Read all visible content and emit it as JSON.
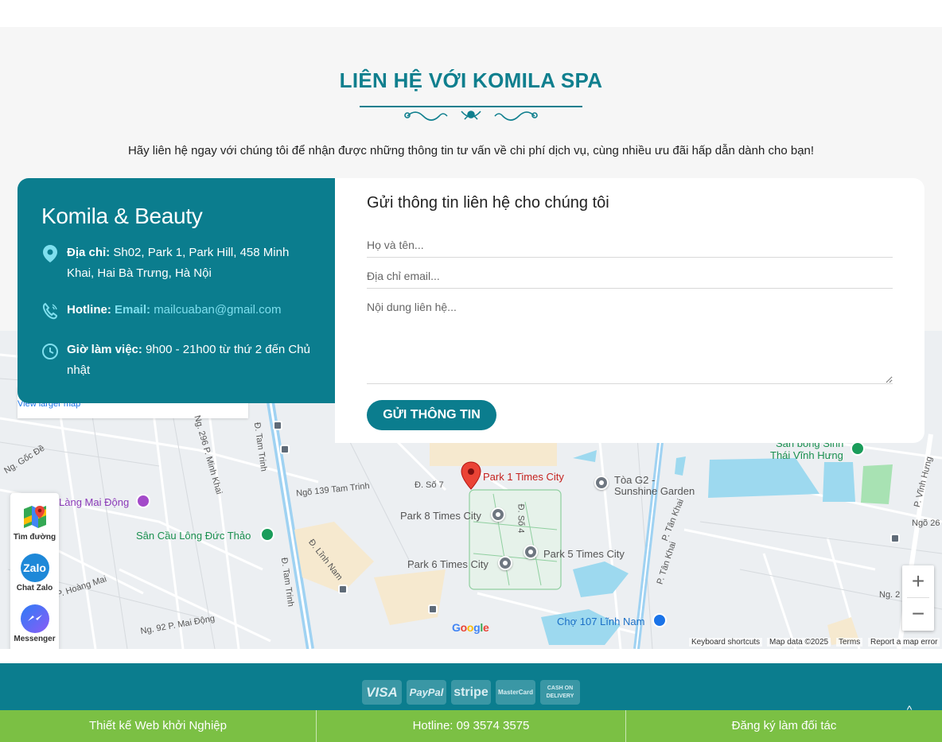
{
  "section": {
    "title": "LIÊN HỆ VỚI KOMILA SPA",
    "description": "Hãy liên hệ ngay với chúng tôi để nhận được những thông tin tư vấn về chi phí dịch vụ, cùng nhiều ưu đãi hấp dẫn dành cho bạn!"
  },
  "info": {
    "title": "Komila & Beauty",
    "address_label": "Địa chỉ:",
    "address_value": "Sh02, Park 1, Park Hill, 458 Minh Khai, Hai Bà Trưng, Hà Nội",
    "hotline_label": "Hotline:",
    "email_label": "Email:",
    "email_value": "mailcuaban@gmail.com",
    "hours_label": "Giờ làm việc:",
    "hours_value": "9h00 - 21h00 từ thứ 2 đến Chủ nhật"
  },
  "form": {
    "title": "Gửi thông tin liên hệ cho chúng tôi",
    "name_placeholder": "Họ và tên...",
    "email_placeholder": "Địa chỉ email...",
    "message_placeholder": "Nội dung liên hệ...",
    "submit_label": "GỬI THÔNG TIN"
  },
  "map": {
    "view_larger": "View larger map",
    "labels": {
      "park1": "Park 1 Times City",
      "park8": "Park 8 Times City",
      "park5": "Park 5 Times City",
      "park6": "Park 6 Times City",
      "toa_g2_line1": "Tòa G2 -",
      "toa_g2_line2": "Sunshine Garden",
      "san_bong_line1": "Sân bóng Sinh",
      "san_bong_line2": "Thái Vĩnh Hưng",
      "san_cau_long": "Sân Cầu Lông Đức Thảo",
      "lang_mai_dong": "Làng Mai Động",
      "cho_107": "Chợ 107 Lĩnh Nam",
      "road_so7": "Đ. Số 7",
      "road_ngo139": "Ngõ 139 Tam Trinh",
      "road_tam_trinh": "Đ. Tam Trinh",
      "road_minh_khai": "Ng. 296 P. Minh Khai",
      "road_goc_de": "Ng. Gốc Đề",
      "road_hoang_mai": "P. Hoàng Mai",
      "road_linh_nam": "Đ. Lĩnh Nam",
      "road_mai_dong": "Ng. 92 P. Mai Động",
      "road_so4": "Đ. Số 4",
      "road_tan_khai": "P. Tân Khai",
      "road_vinh_hung": "P. Vĩnh Hưng",
      "road_ngo2": "Ng. 2",
      "road_ngo": "Ngõ 26"
    },
    "zoom_in": "+",
    "zoom_out": "−",
    "google": "Google",
    "keyboard": "Keyboard shortcuts",
    "map_data": "Map data ©2025",
    "terms": "Terms",
    "report": "Report a map error"
  },
  "widget": {
    "directions": "Tìm đường",
    "zalo": "Chat Zalo",
    "zalo_logo": "Zalo",
    "messenger": "Messenger"
  },
  "payments": [
    "VISA",
    "PayPal",
    "stripe",
    "MasterCard",
    "CASH ON DELIVERY"
  ],
  "bottom_bar": {
    "item1": "Thiết kế Web khởi Nghiệp",
    "item2": "Hotline: 09 3574 3575",
    "item3": "Đăng ký làm đối tác"
  },
  "colors": {
    "teal": "#0b7d8e",
    "green": "#7bc044",
    "accent": "#7fdfee"
  }
}
